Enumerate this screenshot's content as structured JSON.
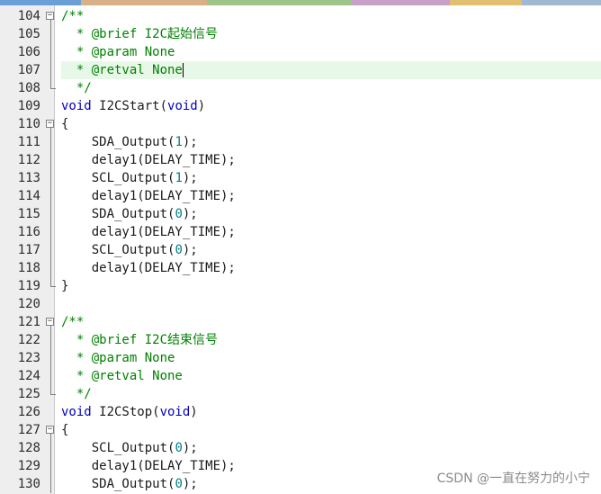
{
  "top_bar_colors": [
    "#6a9fd8",
    "#d8b088",
    "#9ec48a",
    "#c8a0c8",
    "#e0c070",
    "#a0b8d0"
  ],
  "editor": {
    "lines": [
      {
        "num": "104",
        "fold": "open",
        "tokens": [
          {
            "t": "/**",
            "c": "comment"
          }
        ]
      },
      {
        "num": "105",
        "fold": "guide",
        "tokens": [
          {
            "t": "  * @brief I2C起始信号",
            "c": "comment"
          }
        ]
      },
      {
        "num": "106",
        "fold": "guide",
        "tokens": [
          {
            "t": "  * @param None",
            "c": "comment"
          }
        ]
      },
      {
        "num": "107",
        "fold": "guide",
        "highlight": true,
        "caret": true,
        "tokens": [
          {
            "t": "  * @retval None",
            "c": "comment"
          }
        ]
      },
      {
        "num": "108",
        "fold": "end",
        "tokens": [
          {
            "t": "  */",
            "c": "comment"
          }
        ]
      },
      {
        "num": "109",
        "fold": "",
        "tokens": [
          {
            "t": "void",
            "c": "kw"
          },
          {
            "t": " I2CStart(",
            "c": "plain"
          },
          {
            "t": "void",
            "c": "kw"
          },
          {
            "t": ")",
            "c": "plain"
          }
        ]
      },
      {
        "num": "110",
        "fold": "open",
        "tokens": [
          {
            "t": "{",
            "c": "plain"
          }
        ]
      },
      {
        "num": "111",
        "fold": "guide",
        "tokens": [
          {
            "t": "    SDA_Output(",
            "c": "plain"
          },
          {
            "t": "1",
            "c": "num"
          },
          {
            "t": ");",
            "c": "plain"
          }
        ]
      },
      {
        "num": "112",
        "fold": "guide",
        "tokens": [
          {
            "t": "    delay1(DELAY_TIME);",
            "c": "plain"
          }
        ]
      },
      {
        "num": "113",
        "fold": "guide",
        "tokens": [
          {
            "t": "    SCL_Output(",
            "c": "plain"
          },
          {
            "t": "1",
            "c": "num"
          },
          {
            "t": ");",
            "c": "plain"
          }
        ]
      },
      {
        "num": "114",
        "fold": "guide",
        "tokens": [
          {
            "t": "    delay1(DELAY_TIME);",
            "c": "plain"
          }
        ]
      },
      {
        "num": "115",
        "fold": "guide",
        "tokens": [
          {
            "t": "    SDA_Output(",
            "c": "plain"
          },
          {
            "t": "0",
            "c": "num"
          },
          {
            "t": ");",
            "c": "plain"
          }
        ]
      },
      {
        "num": "116",
        "fold": "guide",
        "tokens": [
          {
            "t": "    delay1(DELAY_TIME);",
            "c": "plain"
          }
        ]
      },
      {
        "num": "117",
        "fold": "guide",
        "tokens": [
          {
            "t": "    SCL_Output(",
            "c": "plain"
          },
          {
            "t": "0",
            "c": "num"
          },
          {
            "t": ");",
            "c": "plain"
          }
        ]
      },
      {
        "num": "118",
        "fold": "guide",
        "tokens": [
          {
            "t": "    delay1(DELAY_TIME);",
            "c": "plain"
          }
        ]
      },
      {
        "num": "119",
        "fold": "end",
        "tokens": [
          {
            "t": "}",
            "c": "plain"
          }
        ]
      },
      {
        "num": "120",
        "fold": "",
        "tokens": []
      },
      {
        "num": "121",
        "fold": "open",
        "tokens": [
          {
            "t": "/**",
            "c": "comment"
          }
        ]
      },
      {
        "num": "122",
        "fold": "guide",
        "tokens": [
          {
            "t": "  * @brief I2C结束信号",
            "c": "comment"
          }
        ]
      },
      {
        "num": "123",
        "fold": "guide",
        "tokens": [
          {
            "t": "  * @param None",
            "c": "comment"
          }
        ]
      },
      {
        "num": "124",
        "fold": "guide",
        "tokens": [
          {
            "t": "  * @retval None",
            "c": "comment"
          }
        ]
      },
      {
        "num": "125",
        "fold": "end",
        "tokens": [
          {
            "t": "  */",
            "c": "comment"
          }
        ]
      },
      {
        "num": "126",
        "fold": "",
        "tokens": [
          {
            "t": "void",
            "c": "kw"
          },
          {
            "t": " I2CStop(",
            "c": "plain"
          },
          {
            "t": "void",
            "c": "kw"
          },
          {
            "t": ")",
            "c": "plain"
          }
        ]
      },
      {
        "num": "127",
        "fold": "open",
        "tokens": [
          {
            "t": "{",
            "c": "plain"
          }
        ]
      },
      {
        "num": "128",
        "fold": "guide",
        "tokens": [
          {
            "t": "    SCL_Output(",
            "c": "plain"
          },
          {
            "t": "0",
            "c": "num"
          },
          {
            "t": ");",
            "c": "plain"
          }
        ]
      },
      {
        "num": "129",
        "fold": "guide",
        "tokens": [
          {
            "t": "    delay1(DELAY_TIME);",
            "c": "plain"
          }
        ]
      },
      {
        "num": "130",
        "fold": "guide",
        "tokens": [
          {
            "t": "    SDA_Output(",
            "c": "plain"
          },
          {
            "t": "0",
            "c": "num"
          },
          {
            "t": ");",
            "c": "plain"
          }
        ]
      }
    ]
  },
  "watermark": "CSDN @一直在努力的小宁"
}
